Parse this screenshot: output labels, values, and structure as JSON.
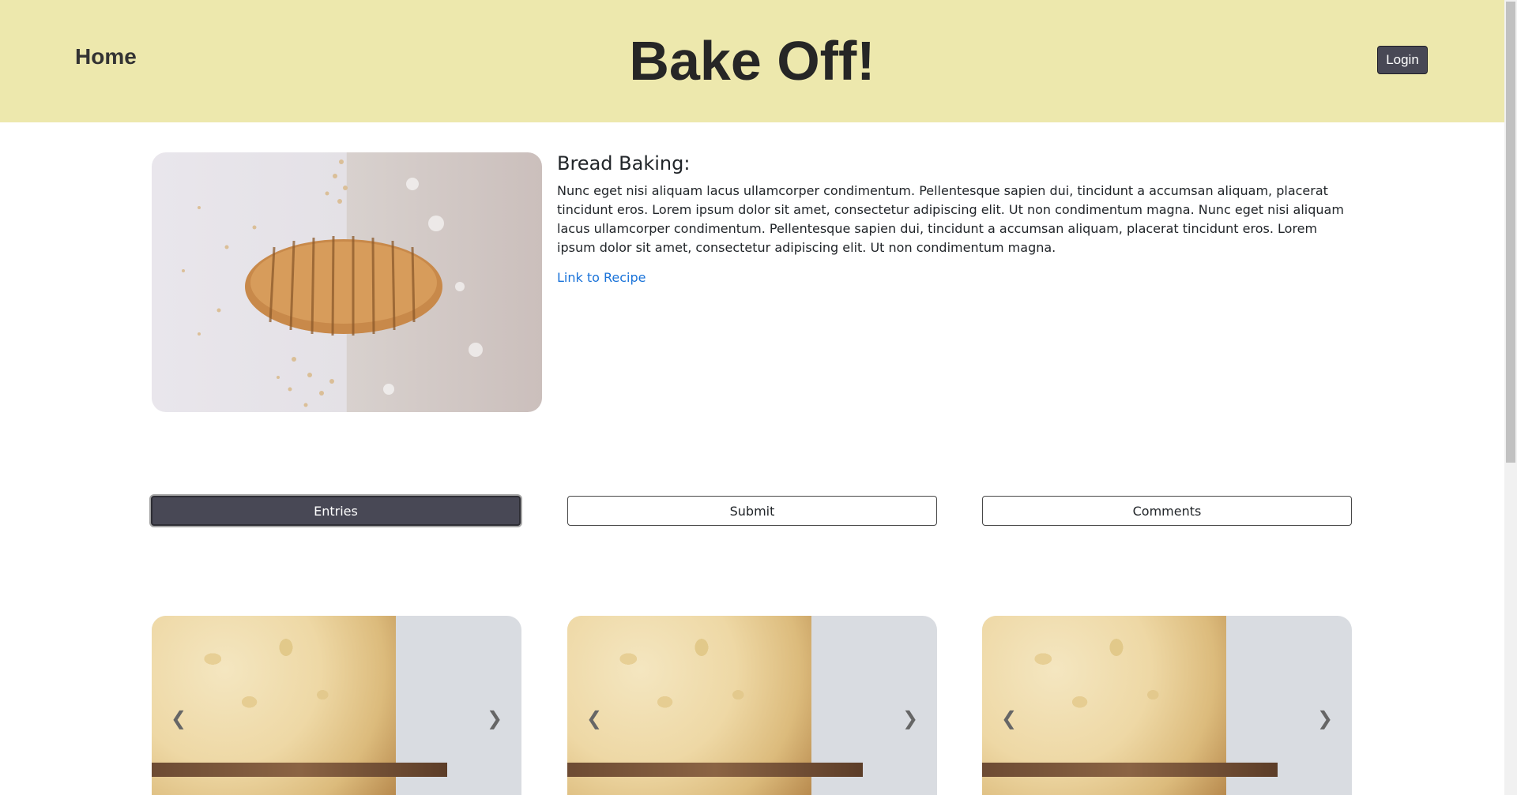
{
  "header": {
    "home_label": "Home",
    "site_title": "Bake Off!",
    "login_label": "Login",
    "background_color": "#ede8ad"
  },
  "feature": {
    "image_icon": "bread-loaf-photo",
    "title": "Bread Baking:",
    "description": "Nunc eget nisi aliquam lacus ullamcorper condimentum. Pellentesque sapien dui, tincidunt a accumsan aliquam, placerat tincidunt eros. Lorem ipsum dolor sit amet, consectetur adipiscing elit. Ut non condimentum magna. Nunc eget nisi aliquam lacus ullamcorper condimentum. Pellentesque sapien dui, tincidunt a accumsan aliquam, placerat tincidunt eros. Lorem ipsum dolor sit amet, consectetur adipiscing elit. Ut non condimentum magna.",
    "link_label": "Link to Recipe",
    "link_color": "#1a73d9"
  },
  "tabs": [
    {
      "label": "Entries",
      "active": true
    },
    {
      "label": "Submit",
      "active": false
    },
    {
      "label": "Comments",
      "active": false
    }
  ],
  "cards": [
    {
      "image_icon": "bread-closeup-photo",
      "prev_icon": "chevron-left-icon",
      "next_icon": "chevron-right-icon"
    },
    {
      "image_icon": "bread-closeup-photo",
      "prev_icon": "chevron-left-icon",
      "next_icon": "chevron-right-icon"
    },
    {
      "image_icon": "bread-closeup-photo",
      "prev_icon": "chevron-left-icon",
      "next_icon": "chevron-right-icon"
    }
  ],
  "colors": {
    "accent_dark": "#484855"
  }
}
